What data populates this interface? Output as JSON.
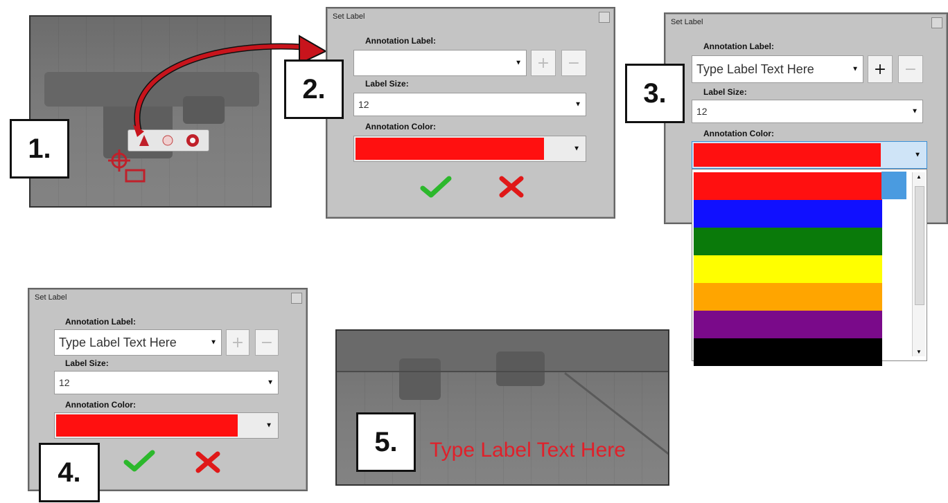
{
  "steps": {
    "one": "1.",
    "two": "2.",
    "three": "3.",
    "four": "4.",
    "five": "5."
  },
  "step1": {
    "toolbar_icons": [
      "label-tool-icon",
      "circle-tool-icon",
      "record-icon"
    ],
    "cursor_icon": "crosshair-icon"
  },
  "dialog2": {
    "title": "Set Label",
    "annotation_label_heading": "Annotation Label:",
    "annotation_label_value": "",
    "add_button": "+",
    "remove_button": "−",
    "label_size_heading": "Label Size:",
    "label_size_value": "12",
    "annotation_color_heading": "Annotation Color:",
    "annotation_color": "#ff1010"
  },
  "dialog3": {
    "title": "Set Label",
    "annotation_label_heading": "Annotation Label:",
    "annotation_label_value": "Type Label Text Here",
    "add_button": "+",
    "remove_button": "−",
    "label_size_heading": "Label Size:",
    "label_size_value": "12",
    "annotation_color_heading": "Annotation Color:",
    "selected_color": "#ff1010",
    "color_options": [
      "#ff1010",
      "#1010ff",
      "#0a7a0a",
      "#ffff00",
      "#ffa500",
      "#7a0a8a",
      "#000000"
    ]
  },
  "dialog4": {
    "title": "Set Label",
    "annotation_label_heading": "Annotation Label:",
    "annotation_label_value": "Type Label Text Here",
    "add_button": "+",
    "remove_button": "−",
    "label_size_heading": "Label Size:",
    "label_size_value": "12",
    "annotation_color_heading": "Annotation Color:",
    "annotation_color": "#ff1010"
  },
  "step5": {
    "overlay_label": "Type Label Text Here",
    "overlay_color": "#e0202a"
  }
}
